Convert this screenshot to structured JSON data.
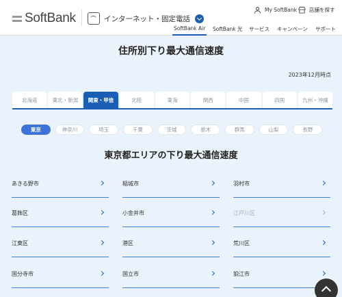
{
  "header": {
    "logo": "SoftBank",
    "service_label": "インターネット・固定電話",
    "util": {
      "mysoftbank": "My SoftBank",
      "store": "店舗を探す"
    },
    "nav": [
      "SoftBank Air",
      "SoftBank 光",
      "サービス",
      "キャンペーン",
      "サポート"
    ]
  },
  "page": {
    "title": "住所別下り最大通信速度",
    "as_of": "2023年12月時点"
  },
  "regions": [
    "北海道",
    "東北・新潟",
    "関東・甲信",
    "北陸",
    "東海",
    "関西",
    "中国",
    "四国",
    "九州・沖縄"
  ],
  "prefectures": [
    "東京",
    "神奈川",
    "埼玉",
    "千葉",
    "茨城",
    "栃木",
    "群馬",
    "山梨",
    "長野"
  ],
  "section_title": "東京都エリアの下り最大通信速度",
  "cities": [
    {
      "name": "あきる野市"
    },
    {
      "name": "稲城市"
    },
    {
      "name": "羽村市"
    },
    {
      "name": "葛飾区"
    },
    {
      "name": "小金井市"
    },
    {
      "name": "江戸川区",
      "disabled": true
    },
    {
      "name": "江東区"
    },
    {
      "name": "港区"
    },
    {
      "name": "荒川区"
    },
    {
      "name": "国分寺市"
    },
    {
      "name": "国立市"
    },
    {
      "name": "狛江市"
    }
  ],
  "colors": {
    "accent": "#1a5fb4",
    "pill_active": "#3d73d9",
    "background": "#eaf3fb"
  }
}
